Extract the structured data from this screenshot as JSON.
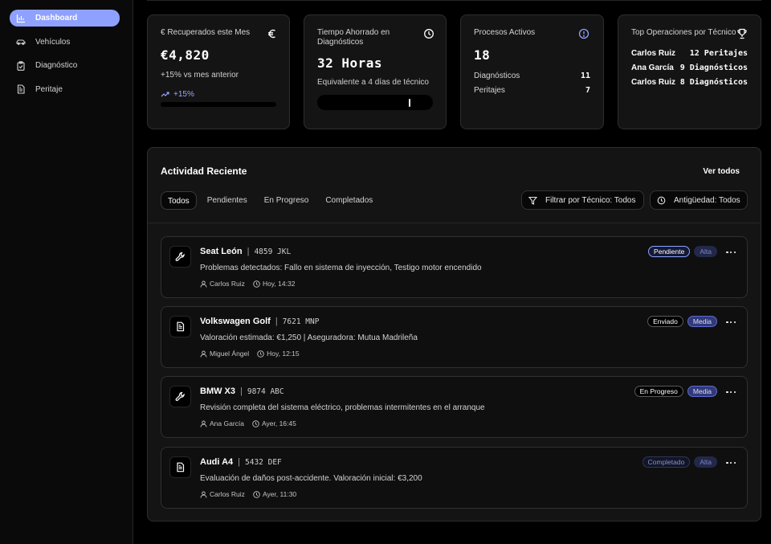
{
  "sidebar": {
    "items": [
      {
        "label": "Dashboard",
        "icon": "bar-chart-icon",
        "active": true
      },
      {
        "label": "Vehículos",
        "icon": "car-icon"
      },
      {
        "label": "Diagnóstico",
        "icon": "clipboard-check-icon"
      },
      {
        "label": "Peritaje",
        "icon": "document-icon"
      }
    ]
  },
  "stats": {
    "recovered": {
      "title": "€ Recuperados este Mes",
      "value": "€4,820",
      "sub": "+15% vs mes anterior",
      "trend": "+15%",
      "icon": "euro-icon"
    },
    "time_saved": {
      "title": "Tiempo Ahorrado en Diagnósticos",
      "value": "32 Horas",
      "sub": "Equivalente a 4 días de técnico",
      "icon": "clock-icon",
      "slider_fraction": 0.8
    },
    "active": {
      "title": "Procesos Activos",
      "value": "18",
      "icon": "alert-circle-icon",
      "rows": [
        {
          "label": "Diagnósticos",
          "value": "11"
        },
        {
          "label": "Peritajes",
          "value": "7"
        }
      ]
    },
    "top": {
      "title": "Top Operaciones por Técnico",
      "icon": "trophy-icon",
      "rows": [
        {
          "name": "Carlos Ruiz",
          "count": "12 Peritajes"
        },
        {
          "name": "Ana García",
          "count": "9 Diagnósticos"
        },
        {
          "name": "Carlos Ruiz",
          "count": "8 Diagnósticos"
        }
      ]
    }
  },
  "activity": {
    "title": "Actividad Reciente",
    "view_all": "Ver todos",
    "tabs": [
      "Todos",
      "Pendientes",
      "En Progreso",
      "Completados"
    ],
    "filter_tech": "Filtrar por Técnico: Todos",
    "filter_age": "Antigüedad: Todos",
    "items": [
      {
        "icon": "wrench-icon",
        "name": "Seat León",
        "plate": "4859 JKL",
        "desc": "Problemas detectados: Fallo en sistema de inyección, Testigo motor encendido",
        "tech": "Carlos Ruiz",
        "time": "Hoy, 14:32",
        "status": "Pendiente",
        "status_kind": "pendiente",
        "priority": "Alta",
        "priority_kind": "alta"
      },
      {
        "icon": "document-icon",
        "name": "Volkswagen Golf",
        "plate": "7621 MNP",
        "desc": "Valoración estimada: €1,250 | Aseguradora: Mutua Madrileña",
        "tech": "Miguel Ángel",
        "time": "Hoy, 12:15",
        "status": "Enviado",
        "status_kind": "enviado",
        "priority": "Media",
        "priority_kind": "media"
      },
      {
        "icon": "wrench-icon",
        "name": "BMW X3",
        "plate": "9874 ABC",
        "desc": "Revisión completa del sistema eléctrico, problemas intermitentes en el arranque",
        "tech": "Ana García",
        "time": "Ayer, 16:45",
        "status": "En Progreso",
        "status_kind": "progreso",
        "priority": "Media",
        "priority_kind": "media"
      },
      {
        "icon": "document-icon",
        "name": "Audi A4",
        "plate": "5432 DEF",
        "desc": "Evaluación de daños post-accidente. Valoración inicial: €3,200",
        "tech": "Carlos Ruiz",
        "time": "Ayer, 11:30",
        "status": "Completado",
        "status_kind": "completado",
        "priority": "Alta",
        "priority_kind": "alta"
      }
    ]
  }
}
